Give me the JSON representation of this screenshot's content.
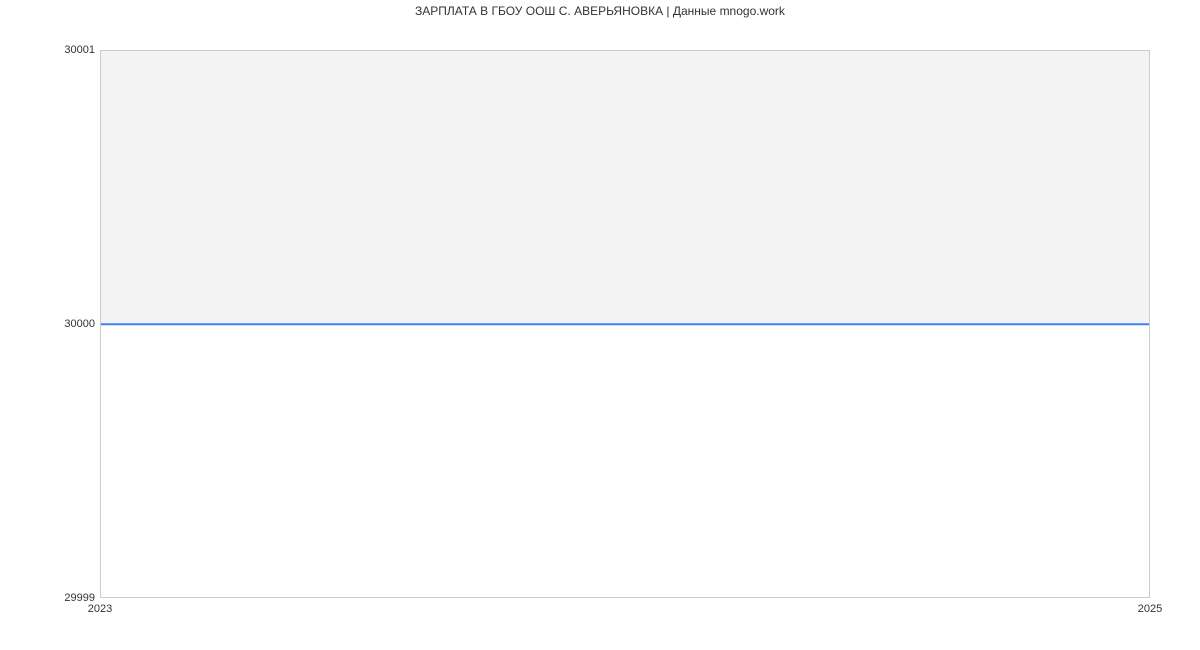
{
  "chart_data": {
    "type": "line",
    "title": "ЗАРПЛАТА В ГБОУ ООШ С. АВЕРЬЯНОВКА | Данные mnogo.work",
    "x": [
      2023,
      2025
    ],
    "values": [
      30000,
      30000
    ],
    "xlabel": "",
    "ylabel": "",
    "x_ticks": [
      "2023",
      "2025"
    ],
    "y_ticks": [
      "29999",
      "30000",
      "30001"
    ],
    "ylim": [
      29999,
      30001
    ],
    "xlim": [
      2023,
      2025
    ],
    "line_color": "#3b82f6"
  }
}
